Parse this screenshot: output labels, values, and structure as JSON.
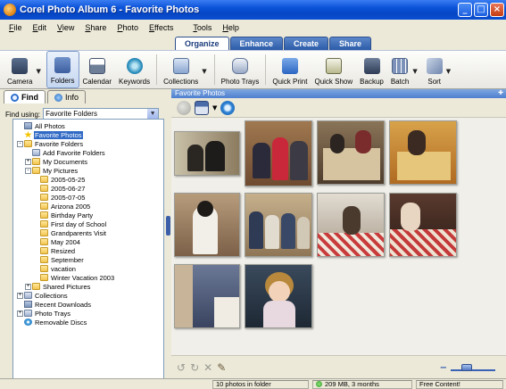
{
  "window": {
    "title": "Corel Photo Album 6 - Favorite Photos"
  },
  "menu": [
    "File",
    "Edit",
    "View",
    "Share",
    "Photo",
    "Effects",
    "Tools",
    "Help"
  ],
  "mode_tabs": [
    {
      "label": "Organize",
      "active": true
    },
    {
      "label": "Enhance",
      "active": false
    },
    {
      "label": "Create",
      "active": false
    },
    {
      "label": "Share",
      "active": false
    }
  ],
  "toolbar": {
    "camera": "Camera",
    "folders": "Folders",
    "calendar": "Calendar",
    "keywords": "Keywords",
    "collections": "Collections",
    "photo_trays": "Photo Trays",
    "quick_print": "Quick Print",
    "quick_show": "Quick Show",
    "backup": "Backup",
    "batch": "Batch",
    "sort": "Sort"
  },
  "left_tabs": {
    "find": "Find",
    "info": "Info"
  },
  "find_using": {
    "label": "Find using:",
    "value": "Favorite Folders"
  },
  "tree": [
    {
      "label": "All Photos",
      "level": 0,
      "icon": "pc"
    },
    {
      "label": "Favorite Photos",
      "level": 0,
      "icon": "star",
      "selected": true
    },
    {
      "label": "Favorite Folders",
      "level": 0,
      "icon": "folder",
      "expander": "-"
    },
    {
      "label": "Add Favorite Folders",
      "level": 1,
      "icon": "tray"
    },
    {
      "label": "My Documents",
      "level": 1,
      "icon": "folder",
      "expander": "+"
    },
    {
      "label": "My Pictures",
      "level": 1,
      "icon": "folder",
      "expander": "-"
    },
    {
      "label": "2005-05-25",
      "level": 2,
      "icon": "folder"
    },
    {
      "label": "2005-06-27",
      "level": 2,
      "icon": "folder"
    },
    {
      "label": "2005-07-05",
      "level": 2,
      "icon": "folder"
    },
    {
      "label": "Arizona 2005",
      "level": 2,
      "icon": "folder"
    },
    {
      "label": "Birthday Party",
      "level": 2,
      "icon": "folder"
    },
    {
      "label": "First day of School",
      "level": 2,
      "icon": "folder"
    },
    {
      "label": "Grandparents Visit",
      "level": 2,
      "icon": "folder"
    },
    {
      "label": "May 2004",
      "level": 2,
      "icon": "folder"
    },
    {
      "label": "Resized",
      "level": 2,
      "icon": "folder"
    },
    {
      "label": "September",
      "level": 2,
      "icon": "folder"
    },
    {
      "label": "vacation",
      "level": 2,
      "icon": "folder"
    },
    {
      "label": "Winter Vacation 2003",
      "level": 2,
      "icon": "folder"
    },
    {
      "label": "Shared Pictures",
      "level": 1,
      "icon": "folder",
      "expander": "+"
    },
    {
      "label": "Collections",
      "level": 0,
      "icon": "tray",
      "expander": "+"
    },
    {
      "label": "Recent Downloads",
      "level": 0,
      "icon": "pc"
    },
    {
      "label": "Photo Trays",
      "level": 0,
      "icon": "tray",
      "expander": "+"
    },
    {
      "label": "Removable Discs",
      "level": 0,
      "icon": "disc"
    }
  ],
  "main": {
    "header": "Favorite Photos"
  },
  "status": {
    "photos": "10 photos in folder",
    "storage": "209 MB, 3 months",
    "promo": "Free Content!"
  },
  "colors": {
    "titlebar": "#0a52d8",
    "selection": "#316ac5",
    "tab_inactive": "#2b5ba8"
  }
}
